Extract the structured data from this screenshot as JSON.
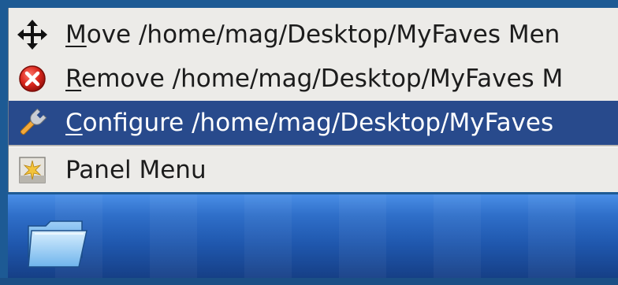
{
  "menu": {
    "items": [
      {
        "icon": "move-arrows-icon",
        "accel": "M",
        "rest": "ove /home/mag/Desktop/MyFaves Men",
        "selected": false
      },
      {
        "icon": "remove-red-x-icon",
        "accel": "R",
        "rest": "emove /home/mag/Desktop/MyFaves M",
        "selected": false
      },
      {
        "icon": "wrench-icon",
        "accel": "C",
        "rest": "onfigure /home/mag/Desktop/MyFaves",
        "selected": true
      },
      {
        "icon": "panel-menu-icon",
        "accel": "",
        "rest": "Panel Menu",
        "selected": false
      }
    ]
  },
  "panel": {
    "launcher_icon": "folder-icon"
  },
  "colors": {
    "menu_bg": "#ecebe8",
    "selection_bg": "#284a8c",
    "panel_blue": "#2f6fc9",
    "frame_blue": "#1d5a94"
  }
}
